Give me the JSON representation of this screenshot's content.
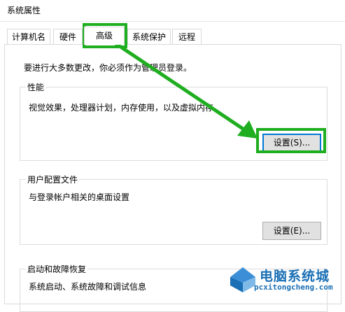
{
  "window": {
    "title": "系统属性"
  },
  "tabs": [
    {
      "label": "计算机名"
    },
    {
      "label": "硬件"
    },
    {
      "label": "高级",
      "active": true
    },
    {
      "label": "系统保护"
    },
    {
      "label": "远程"
    }
  ],
  "admin_note": "要进行大多数更改，你必须作为管理员登录。",
  "performance": {
    "title": "性能",
    "description": "视觉效果，处理器计划，内存使用，以及虚拟内存",
    "button_label": "设置(S)..."
  },
  "user_profiles": {
    "title": "用户配置文件",
    "description": "与登录帐户相关的桌面设置",
    "button_label": "设置(E)..."
  },
  "startup_recovery": {
    "title": "启动和故障恢复",
    "description": "系统启动、系统故障和调试信息"
  },
  "annotation": {
    "color": "#1fae1f"
  },
  "watermark": {
    "line1": "电脑系统城",
    "line2": "pcxitongcheng.com",
    "color": "#1a6fb5"
  }
}
